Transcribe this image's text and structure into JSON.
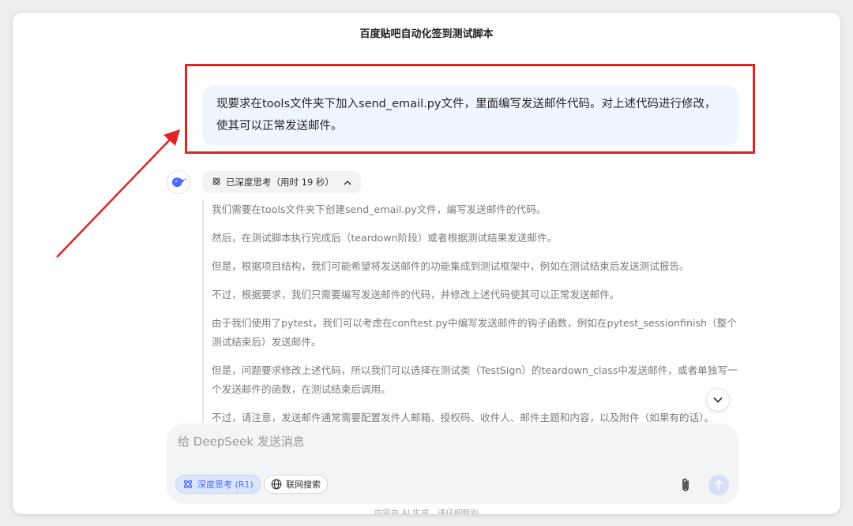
{
  "header": {
    "title": "百度贴吧自动化签到测试脚本"
  },
  "user_message": {
    "text": "现要求在tools文件夹下加入send_email.py文件，里面编写发送邮件代码。对上述代码进行修改，使其可以正常发送邮件。"
  },
  "thinking": {
    "label": "已深度思考（用时 19 秒）",
    "paragraphs": [
      "我们需要在tools文件夹下创建send_email.py文件，编写发送邮件的代码。",
      "然后，在测试脚本执行完成后（teardown阶段）或者根据测试结果发送邮件。",
      "但是，根据项目结构，我们可能希望将发送邮件的功能集成到测试框架中，例如在测试结束后发送测试报告。",
      "不过，根据要求，我们只需要编写发送邮件的代码，并修改上述代码使其可以正常发送邮件。",
      "由于我们使用了pytest，我们可以考虑在conftest.py中编写发送邮件的钩子函数，例如在pytest_sessionfinish（整个测试结束后）发送邮件。",
      "但是，问题要求修改上述代码，所以我们可以选择在测试类（TestSign）的teardown_class中发送邮件，或者单独写一个发送邮件的函数，在测试结束后调用。",
      "不过，请注意，发送邮件通常需要配置发件人邮箱、授权码、收件人、邮件主题和内容，以及附件（如果有的话）。"
    ]
  },
  "composer": {
    "placeholder": "给 DeepSeek 发送消息",
    "deep_think_label": "深度思考 (R1)",
    "web_search_label": "联网搜索"
  },
  "footer": {
    "text": "内容由 AI 生成，请仔细甄别"
  },
  "colors": {
    "accent": "#4d6bfe",
    "highlight_border": "#e02424",
    "user_bubble": "#eff6ff"
  },
  "icons": {
    "avatar": "deepseek-whale-icon",
    "thinking": "atom-icon",
    "toggle": "chevron-up-icon",
    "scroll": "chevron-down-icon",
    "deep_think": "atom-icon",
    "web_search": "globe-icon",
    "attach": "paperclip-icon",
    "send": "arrow-up-icon"
  }
}
